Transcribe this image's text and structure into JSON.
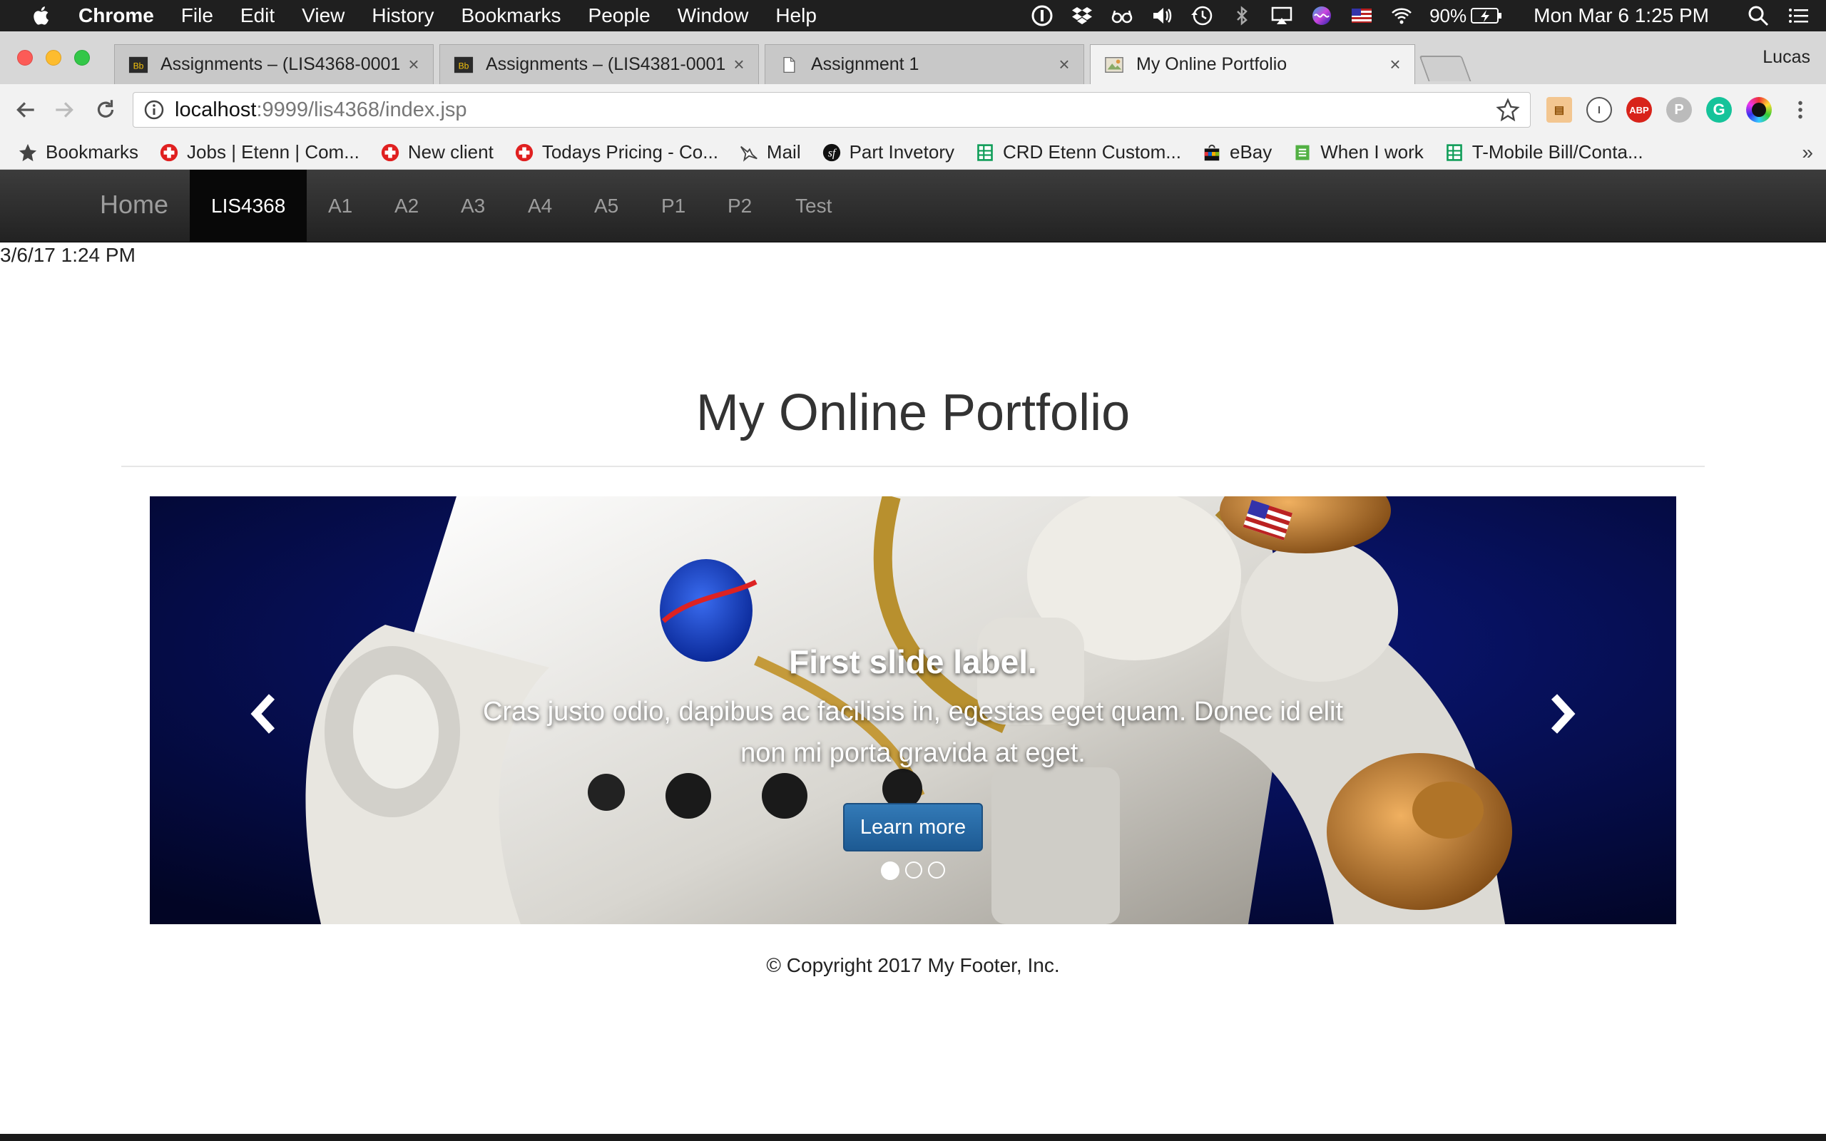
{
  "menubar": {
    "app": "Chrome",
    "items": [
      "File",
      "Edit",
      "View",
      "History",
      "Bookmarks",
      "People",
      "Window",
      "Help"
    ],
    "battery": "90%",
    "clock": "Mon Mar 6  1:25 PM"
  },
  "tabs": [
    {
      "title": "Assignments – (LIS4368-0001",
      "favicon": "blackboard-icon",
      "active": false
    },
    {
      "title": "Assignments – (LIS4381-0001",
      "favicon": "blackboard-icon",
      "active": false
    },
    {
      "title": "Assignment 1",
      "favicon": "document-icon",
      "active": false
    },
    {
      "title": "My Online Portfolio",
      "favicon": "portfolio-icon",
      "active": true
    }
  ],
  "profile": "Lucas",
  "omnibox": {
    "host": "localhost",
    "path": ":9999/lis4368/index.jsp"
  },
  "extensions": [
    "clipboard-extension-icon",
    "1password-extension-icon",
    "adblock-extension-icon",
    "pushbullet-extension-icon",
    "grammarly-extension-icon",
    "color-extension-icon"
  ],
  "bookmarks": [
    {
      "label": "Bookmarks",
      "icon": "star-icon"
    },
    {
      "label": "Jobs | Etenn | Com...",
      "icon": "red-cross-icon"
    },
    {
      "label": "New client",
      "icon": "red-cross-icon"
    },
    {
      "label": "Todays Pricing - Co...",
      "icon": "red-cross-icon"
    },
    {
      "label": "Mail",
      "icon": "mail-bird-icon"
    },
    {
      "label": "Part Invetory",
      "icon": "symfony-icon"
    },
    {
      "label": "CRD Etenn Custom...",
      "icon": "sheets-icon"
    },
    {
      "label": "eBay",
      "icon": "ebay-bag-icon"
    },
    {
      "label": "When I work",
      "icon": "forms-icon"
    },
    {
      "label": "T-Mobile Bill/Conta...",
      "icon": "sheets-icon"
    }
  ],
  "navbar": {
    "brand": "Home",
    "links": [
      "LIS4368",
      "A1",
      "A2",
      "A3",
      "A4",
      "A5",
      "P1",
      "P2",
      "Test"
    ],
    "active": "LIS4368"
  },
  "timestamp": "3/6/17 1:24 PM",
  "page": {
    "title": "My Online Portfolio",
    "carousel": {
      "heading": "First slide label.",
      "text": "Cras justo odio, dapibus ac facilisis in, egestas eget quam. Donec id elit non mi porta gravida at eget.",
      "button": "Learn more",
      "slide_count": 3,
      "active_slide": 1
    },
    "footer": "© Copyright 2017 My Footer, Inc."
  },
  "colors": {
    "navbar": "#222222",
    "button": "#337ab7",
    "slide_bg": "#050a3a"
  }
}
